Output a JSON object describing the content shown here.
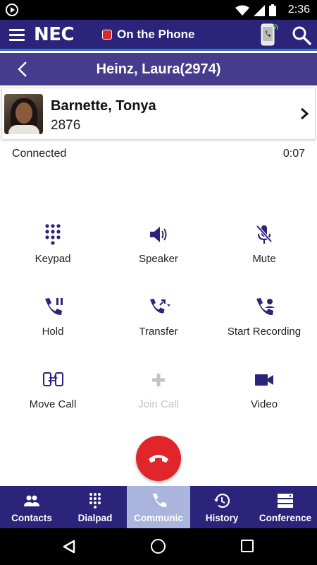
{
  "status_bar": {
    "time": "2:36",
    "icons": [
      "play-circle-icon",
      "wifi-icon",
      "signal-icon",
      "battery-icon"
    ]
  },
  "header": {
    "brand": "NEC",
    "presence_status": "On the Phone",
    "presence_color": "#d32b2b",
    "icons": [
      "menu-icon",
      "phone-mode-icon",
      "search-icon"
    ]
  },
  "title_bar": {
    "title": "Heinz, Laura(2974)",
    "back_icon": "chevron-left-icon"
  },
  "contact": {
    "name": "Barnette, Tonya",
    "extension": "2876"
  },
  "call": {
    "status": "Connected",
    "timer": "0:07"
  },
  "actions": [
    {
      "label": "Keypad",
      "icon": "keypad-icon",
      "enabled": true
    },
    {
      "label": "Speaker",
      "icon": "speaker-icon",
      "enabled": true
    },
    {
      "label": "Mute",
      "icon": "mic-off-icon",
      "enabled": true
    },
    {
      "label": "Hold",
      "icon": "phone-pause-icon",
      "enabled": true
    },
    {
      "label": "Transfer",
      "icon": "phone-transfer-icon",
      "enabled": true
    },
    {
      "label": "Start Recording",
      "icon": "record-icon",
      "enabled": true
    },
    {
      "label": "Move Call",
      "icon": "move-call-icon",
      "enabled": true
    },
    {
      "label": "Join Call",
      "icon": "plus-icon",
      "enabled": false
    },
    {
      "label": "Video",
      "icon": "video-camera-icon",
      "enabled": true
    }
  ],
  "end_call": {
    "icon": "end-call-icon",
    "color": "#e0262a"
  },
  "tabs": [
    {
      "label": "Contacts",
      "icon": "people-icon",
      "active": false
    },
    {
      "label": "Dialpad",
      "icon": "dialpad-icon",
      "active": false
    },
    {
      "label": "Communic",
      "icon": "phone-icon",
      "active": true
    },
    {
      "label": "History",
      "icon": "history-icon",
      "active": false
    },
    {
      "label": "Conference",
      "icon": "conference-icon",
      "active": false
    }
  ],
  "colors": {
    "header_bg": "#2c237a",
    "title_bg": "#463c8e",
    "icon_color": "#2c237a",
    "active_tab_bg": "#aab5de"
  }
}
